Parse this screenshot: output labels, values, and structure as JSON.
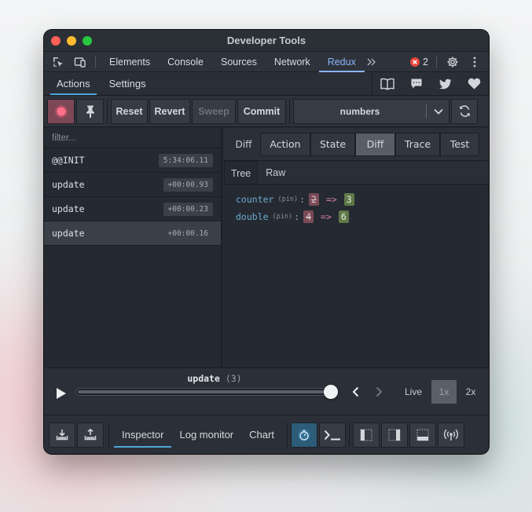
{
  "window": {
    "title": "Developer Tools"
  },
  "devtools_tabs": [
    {
      "label": "Elements"
    },
    {
      "label": "Console"
    },
    {
      "label": "Sources"
    },
    {
      "label": "Network"
    },
    {
      "label": "Redux"
    }
  ],
  "devtools": {
    "more_icon": "double-chevron-right-icon",
    "error_count": "2"
  },
  "subtabs": {
    "actions": "Actions",
    "settings": "Settings"
  },
  "toolbar": {
    "reset": "Reset",
    "revert": "Revert",
    "sweep": "Sweep",
    "commit": "Commit",
    "instance": "numbers"
  },
  "filter": {
    "placeholder": "filter..."
  },
  "actions": [
    {
      "name": "@@INIT",
      "time": "5:34:06.11"
    },
    {
      "name": "update",
      "time": "+00:00.93"
    },
    {
      "name": "update",
      "time": "+00:00.23"
    },
    {
      "name": "update",
      "time": "+00:00.16"
    }
  ],
  "inspector_tabs": {
    "diff_label": "Diff",
    "action": "Action",
    "state": "State",
    "diff": "Diff",
    "trace": "Trace",
    "test": "Test"
  },
  "tree_tabs": {
    "tree": "Tree",
    "raw": "Raw"
  },
  "diff": [
    {
      "key": "counter",
      "pin": "(pin)",
      "old": "2",
      "arrow": "=>",
      "new": "3"
    },
    {
      "key": "double",
      "pin": "(pin)",
      "old": "4",
      "arrow": "=>",
      "new": "6"
    }
  ],
  "slider": {
    "label": "update",
    "count": "(3)",
    "live": "Live",
    "speed1": "1x",
    "speed2": "2x",
    "position": 1.0
  },
  "bottom_tabs": {
    "inspector": "Inspector",
    "log_monitor": "Log monitor",
    "chart": "Chart"
  },
  "colors": {
    "accent": "#4fa6d8",
    "redux_tab": "#8ab4f8",
    "error": "#e8453c",
    "record": "#ff5c7a"
  }
}
